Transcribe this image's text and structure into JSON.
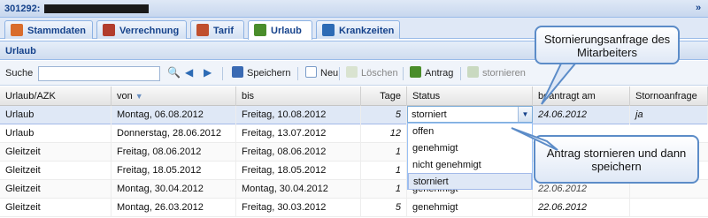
{
  "window": {
    "title": "301292:",
    "collapse_icon": "double-chevron-right-icon"
  },
  "tabs": [
    {
      "label": "Stammdaten",
      "icon": "person-icon",
      "color": "#d96c2b"
    },
    {
      "label": "Verrechnung",
      "icon": "billing-icon",
      "color": "#b23c2c"
    },
    {
      "label": "Tarif",
      "icon": "tariff-icon",
      "color": "#c0502e"
    },
    {
      "label": "Urlaub",
      "icon": "vacation-icon",
      "color": "#4a8d2a",
      "active": true
    },
    {
      "label": "Krankzeiten",
      "icon": "calendar-icon",
      "color": "#2d6bb5"
    }
  ],
  "panel": {
    "title": "Urlaub"
  },
  "toolbar": {
    "search_label": "Suche",
    "search_value": "",
    "save_label": "Speichern",
    "new_label": "Neu",
    "delete_label": "Löschen",
    "request_label": "Antrag",
    "cancel_label": "stornieren"
  },
  "grid": {
    "columns": [
      "Urlaub/AZK",
      "von",
      "bis",
      "Tage",
      "Status",
      "beantragt am",
      "Stornoanfrage"
    ],
    "rows": [
      {
        "type": "Urlaub",
        "von": "Montag, 06.08.2012",
        "bis": "Freitag, 10.08.2012",
        "tage": "5",
        "status": "storniert",
        "beantragt": "24.06.2012",
        "storno": "ja"
      },
      {
        "type": "Urlaub",
        "von": "Donnerstag, 28.06.2012",
        "bis": "Freitag, 13.07.2012",
        "tage": "12",
        "status": "",
        "beantragt": "",
        "storno": ""
      },
      {
        "type": "Gleitzeit",
        "von": "Freitag, 08.06.2012",
        "bis": "Freitag, 08.06.2012",
        "tage": "1",
        "status": "",
        "beantragt": "",
        "storno": ""
      },
      {
        "type": "Gleitzeit",
        "von": "Freitag, 18.05.2012",
        "bis": "Freitag, 18.05.2012",
        "tage": "1",
        "status": "",
        "beantragt": "",
        "storno": ""
      },
      {
        "type": "Gleitzeit",
        "von": "Montag, 30.04.2012",
        "bis": "Montag, 30.04.2012",
        "tage": "1",
        "status": "genehmigt",
        "beantragt": "22.06.2012",
        "storno": ""
      },
      {
        "type": "Gleitzeit",
        "von": "Montag, 26.03.2012",
        "bis": "Freitag, 30.03.2012",
        "tage": "5",
        "status": "genehmigt",
        "beantragt": "22.06.2012",
        "storno": ""
      }
    ]
  },
  "status_combo": {
    "value": "storniert",
    "options": [
      "offen",
      "genehmigt",
      "nicht genehmigt",
      "storniert"
    ],
    "selected_index": 3
  },
  "callouts": {
    "employee_request": "Stornierungsanfrage des Mitarbeiters",
    "instruction": "Antrag stornieren und dann speichern"
  }
}
